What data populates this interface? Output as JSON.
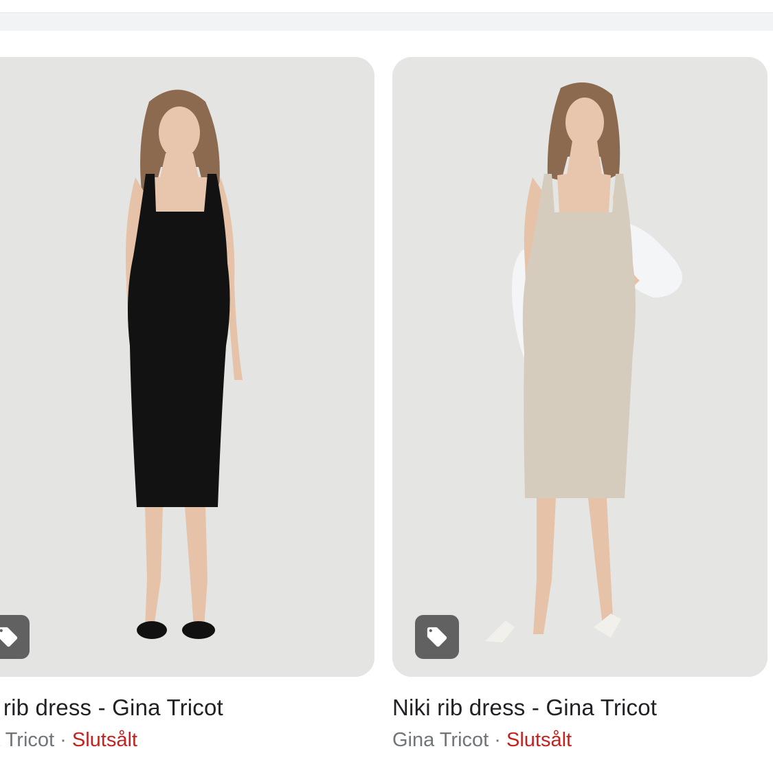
{
  "results": [
    {
      "title": "i rib dress - Gina Tricot",
      "source": "a Tricot",
      "separator": "·",
      "status": "Slutsålt",
      "dress_color": "#121212",
      "shoe_color": "#111111"
    },
    {
      "title": "Niki rib dress - Gina Tricot",
      "source": "Gina Tricot",
      "separator": "·",
      "status": "Slutsålt",
      "dress_color": "#d6ccbe",
      "shoe_color": "#f2f0eb"
    }
  ],
  "colors": {
    "status_red": "#c5221f",
    "tag_button_bg": "#616161",
    "image_bg": "#e5e5e3"
  },
  "icons": {
    "tag": "price-tag-icon"
  }
}
